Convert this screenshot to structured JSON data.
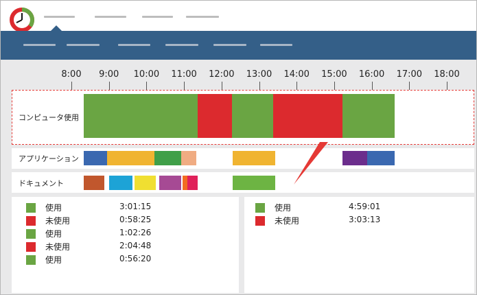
{
  "colors": {
    "used": "#6aa543",
    "unused": "#dc2a2e",
    "nav_bg": "#345f88",
    "dash": "#e53935"
  },
  "icons": {
    "logo": "clock-logo-icon"
  },
  "timeline": {
    "hours": [
      "8:00",
      "9:00",
      "10:00",
      "11:00",
      "12:00",
      "13:00",
      "14:00",
      "15:00",
      "16:00",
      "17:00",
      "18:00"
    ]
  },
  "rows": {
    "computer_label": "コンピュータ使用",
    "applications_label": "アプリケーション",
    "documents_label": "ドキュメント"
  },
  "computer_usage": [
    {
      "start": "8:20",
      "end": "11:22",
      "state": "used"
    },
    {
      "start": "11:22",
      "end": "12:17",
      "state": "unused"
    },
    {
      "start": "12:17",
      "end": "13:23",
      "state": "used"
    },
    {
      "start": "13:23",
      "end": "15:13",
      "state": "unused"
    },
    {
      "start": "15:13",
      "end": "16:37",
      "state": "used"
    }
  ],
  "applications": [
    {
      "start": "8:20",
      "end": "8:57",
      "color": "#3a68b0"
    },
    {
      "start": "8:57",
      "end": "10:13",
      "color": "#f0b431"
    },
    {
      "start": "10:13",
      "end": "10:55",
      "color": "#3f9f48"
    },
    {
      "start": "10:55",
      "end": "11:20",
      "color": "#f0ac82"
    },
    {
      "start": "12:18",
      "end": "13:26",
      "color": "#f0b431"
    },
    {
      "start": "15:13",
      "end": "15:53",
      "color": "#6b2d8c"
    },
    {
      "start": "15:53",
      "end": "16:37",
      "color": "#3a68b0"
    }
  ],
  "documents": [
    {
      "start": "8:20",
      "end": "8:53",
      "color": "#c1572d"
    },
    {
      "start": "9:00",
      "end": "9:38",
      "color": "#1da3d6"
    },
    {
      "start": "9:41",
      "end": "10:15",
      "color": "#f0df31"
    },
    {
      "start": "10:20",
      "end": "10:55",
      "color": "#a64a94"
    },
    {
      "start": "10:58",
      "end": "11:05",
      "color": "#f26b21"
    },
    {
      "start": "11:05",
      "end": "11:22",
      "color": "#e0215a"
    },
    {
      "start": "12:18",
      "end": "13:26",
      "color": "#6db443"
    }
  ],
  "summary_left": [
    {
      "label": "使用",
      "time": "3:01:15",
      "state": "used"
    },
    {
      "label": "未使用",
      "time": "0:58:25",
      "state": "unused"
    },
    {
      "label": "使用",
      "time": "1:02:26",
      "state": "used"
    },
    {
      "label": "未使用",
      "time": "2:04:48",
      "state": "unused"
    },
    {
      "label": "使用",
      "time": "0:56:20",
      "state": "used"
    }
  ],
  "summary_right": [
    {
      "label": "使用",
      "time": "4:59:01",
      "state": "used"
    },
    {
      "label": "未使用",
      "time": "3:03:13",
      "state": "unused"
    }
  ]
}
